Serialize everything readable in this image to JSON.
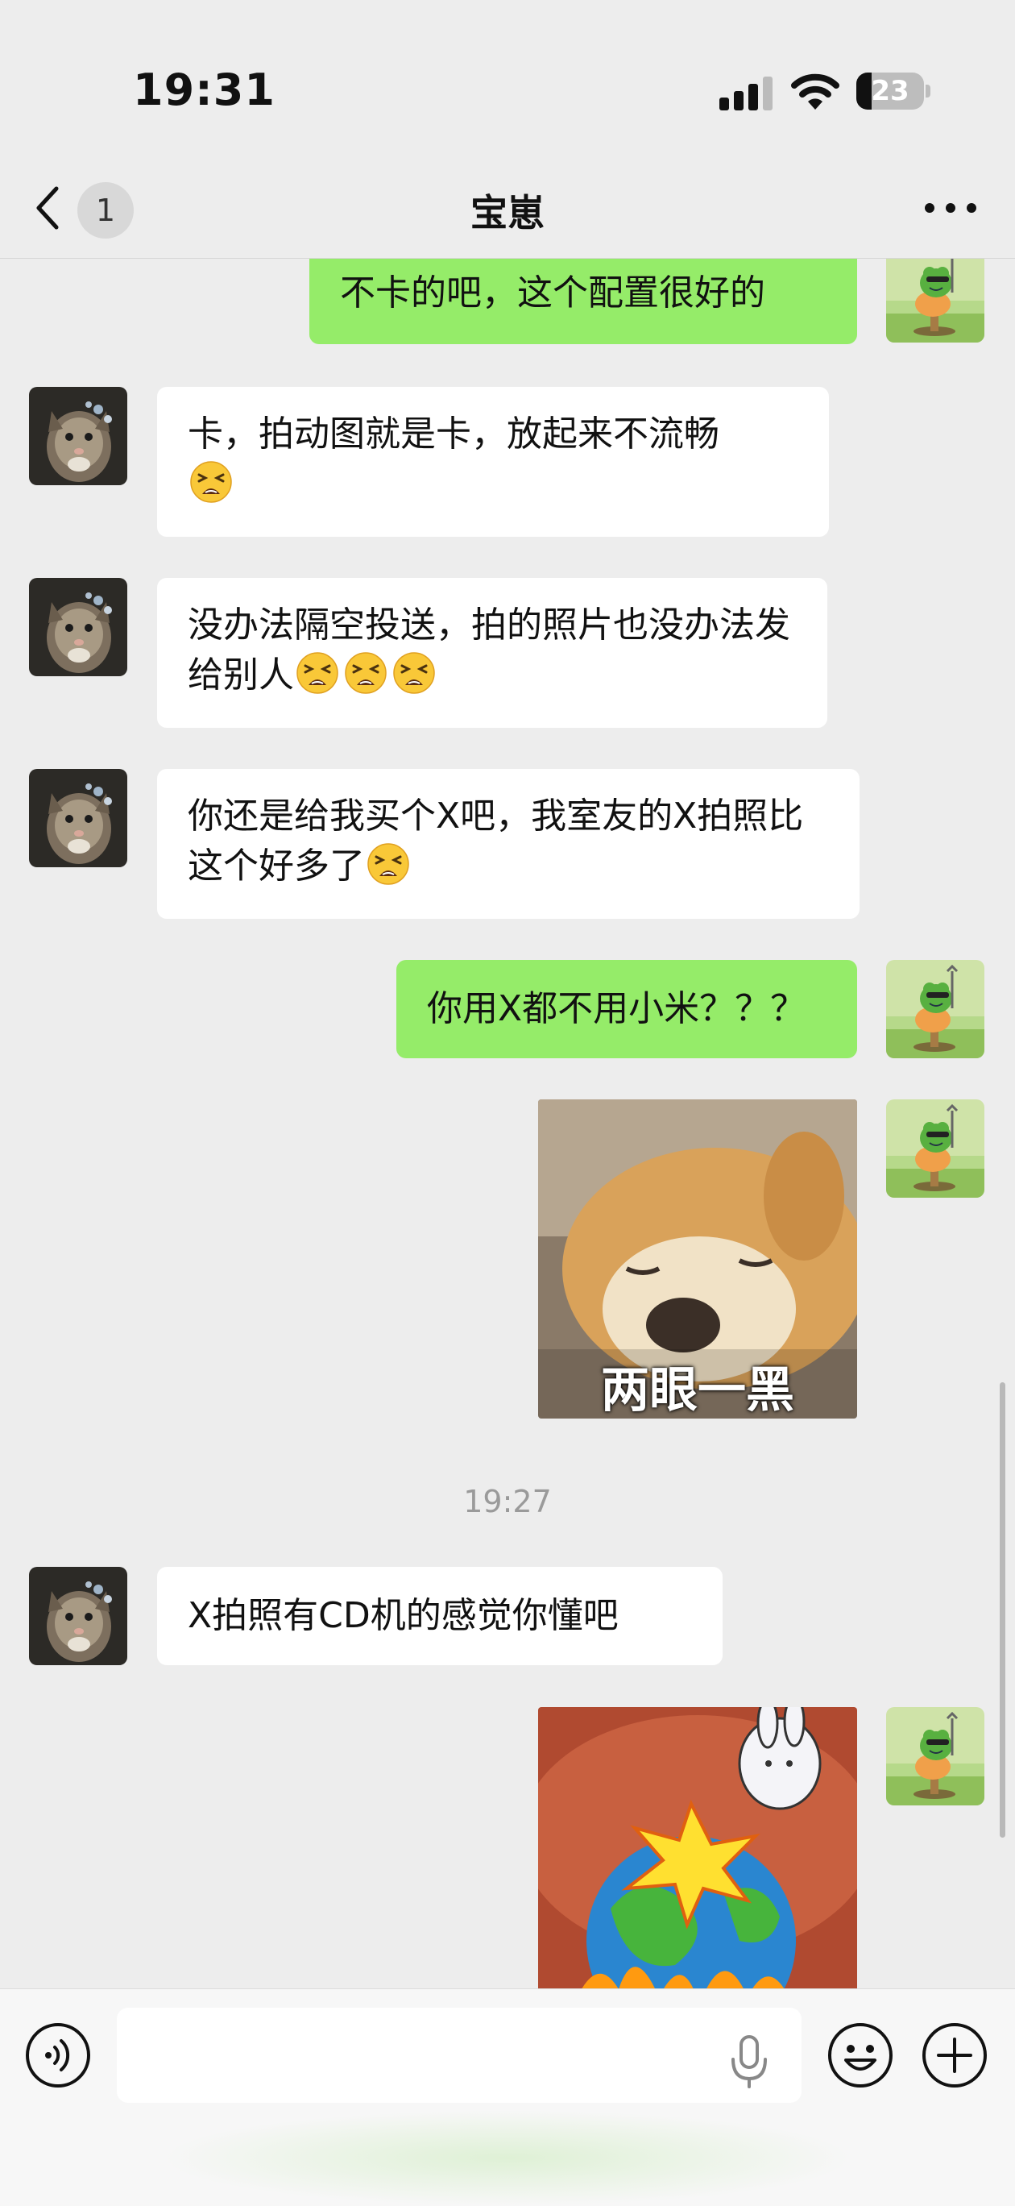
{
  "status_bar": {
    "time": "19:31",
    "battery": "23",
    "battery_level": 0.23
  },
  "nav": {
    "unread_count": "1",
    "title": "宝崽",
    "more_icon": "more-dots-icon",
    "back_icon": "chevron-left-icon"
  },
  "messages": [
    {
      "side": "out",
      "text": "不卡的吧，这个配置很好的"
    },
    {
      "side": "in",
      "text": "卡，拍动图就是卡，放起来不流畅",
      "emoji": "tired-face-emoji x1"
    },
    {
      "side": "in",
      "text": "没办法隔空投送，拍的照片也没办法发给别人",
      "emoji": "tired-face-emoji x3"
    },
    {
      "side": "in",
      "text": "你还是给我买个X吧，我室友的X拍照比这个好多了",
      "emoji": "tired-face-emoji x1"
    },
    {
      "side": "out",
      "text": "你用X都不用小米？？？"
    },
    {
      "side": "out",
      "sticker": "shiba-dog-sticker",
      "sticker_caption": "两眼一黑"
    },
    {
      "timestamp": "19:27"
    },
    {
      "side": "in",
      "text": "X拍照有CD机的感觉你懂吧"
    },
    {
      "side": "out",
      "sticker": "exploding-earth-rabbit-sticker"
    }
  ],
  "colors": {
    "outgoing_bubble": "#95ec69",
    "incoming_bubble": "#ffffff",
    "background": "#ededed"
  },
  "input_bar": {
    "placeholder": "",
    "icons": [
      "voice-icon",
      "microphone-icon",
      "emoji-icon",
      "plus-icon"
    ]
  }
}
